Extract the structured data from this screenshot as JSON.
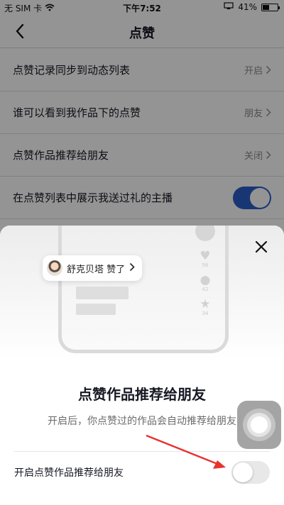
{
  "status_bar": {
    "carrier": "无 SIM 卡",
    "time": "下午7:52",
    "battery": "41%"
  },
  "nav": {
    "title": "点赞"
  },
  "settings": [
    {
      "label": "点赞记录同步到动态列表",
      "value": "开启"
    },
    {
      "label": "谁可以看到我作品下的点赞",
      "value": "朋友"
    },
    {
      "label": "点赞作品推荐给朋友",
      "value": "关闭"
    },
    {
      "label": "在点赞列表中展示我送过礼的主播",
      "toggle_on": true
    }
  ],
  "sheet": {
    "bubble_text": "舒克贝塔 赞了",
    "counts": [
      "56",
      "42",
      "34"
    ],
    "title": "点赞作品推荐给朋友",
    "description": "开启后，你点赞过的作品会自动推荐给朋友",
    "toggle_label": "开启点赞作品推荐给朋友",
    "toggle_on": false
  },
  "colors": {
    "accent": "#2c5ec8",
    "annotation_arrow": "#e8322e"
  }
}
